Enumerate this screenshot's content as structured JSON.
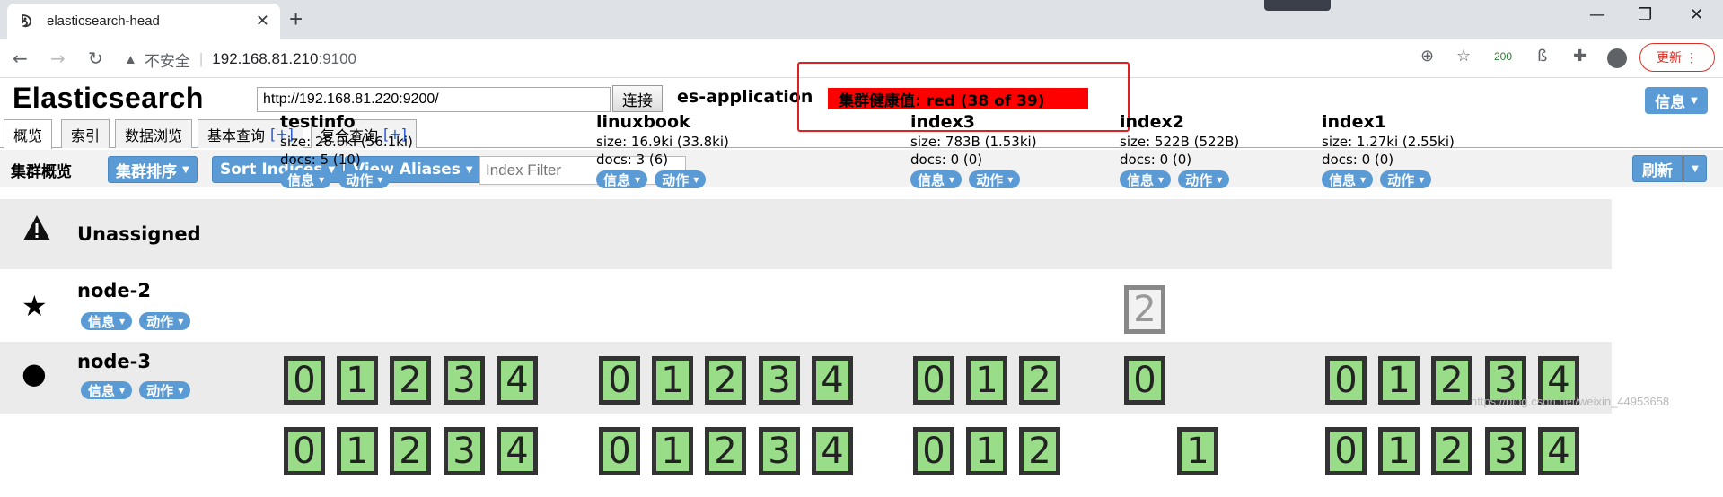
{
  "browser": {
    "tab_title": "elasticsearch-head",
    "tab_close": "✕",
    "new_tab": "+",
    "security_label": "不安全",
    "url_host": "192.168.81.210",
    "url_port": ":9100",
    "ext_badge": "200",
    "update_label": "更新"
  },
  "app": {
    "brand": "Elasticsearch",
    "cluster_url": "http://192.168.81.220:9200/",
    "connect_label": "连接",
    "cluster_name": "es-application",
    "health_text": "集群健康值: red (38 of 39)",
    "info_label": "信息",
    "colors": {
      "health": "#ff0000",
      "shard": "#99dd88",
      "button": "#5b9bd5"
    }
  },
  "tabs": [
    {
      "label": "概览",
      "plus": ""
    },
    {
      "label": "索引",
      "plus": ""
    },
    {
      "label": "数据浏览",
      "plus": ""
    },
    {
      "label": "基本查询",
      "plus": "[+]"
    },
    {
      "label": "复合查询",
      "plus": "[+]"
    }
  ],
  "toolbar": {
    "title": "集群概览",
    "sort_cluster": "集群排序",
    "sort_indices": "Sort Indices",
    "view_aliases": "View Aliases",
    "filter_placeholder": "Index Filter",
    "refresh_label": "刷新"
  },
  "pill_labels": {
    "info": "信息",
    "action": "动作"
  },
  "indices": [
    {
      "name": "testinfo",
      "size": "size: 28.0ki (56.1ki)",
      "docs": "docs: 5 (10)"
    },
    {
      "name": "linuxbook",
      "size": "size: 16.9ki (33.8ki)",
      "docs": "docs: 3 (6)"
    },
    {
      "name": "index3",
      "size": "size: 783B (1.53ki)",
      "docs": "docs: 0 (0)"
    },
    {
      "name": "index2",
      "size": "size: 522B (522B)",
      "docs": "docs: 0 (0)"
    },
    {
      "name": "index1",
      "size": "size: 1.27ki (2.55ki)",
      "docs": "docs: 0 (0)"
    }
  ],
  "rows": {
    "unassigned": {
      "name": "Unassigned",
      "shards": {
        "index2": [
          "2"
        ]
      }
    },
    "node2": {
      "name": "node-2",
      "shards": {
        "testinfo": [
          "0",
          "1",
          "2",
          "3",
          "4"
        ],
        "linuxbook": [
          "0",
          "1",
          "2",
          "3",
          "4"
        ],
        "index3": [
          "0",
          "1",
          "2"
        ],
        "index2": [
          "0"
        ],
        "index1": [
          "0",
          "1",
          "2",
          "3",
          "4"
        ]
      }
    },
    "node3": {
      "name": "node-3",
      "shards": {
        "testinfo": [
          "0",
          "1",
          "2",
          "3",
          "4"
        ],
        "linuxbook": [
          "0",
          "1",
          "2",
          "3",
          "4"
        ],
        "index3": [
          "0",
          "1",
          "2"
        ],
        "index2": [
          "1"
        ],
        "index1": [
          "0",
          "1",
          "2",
          "3",
          "4"
        ]
      }
    }
  },
  "watermark": "https://blog.csdn.net/weixin_44953658"
}
